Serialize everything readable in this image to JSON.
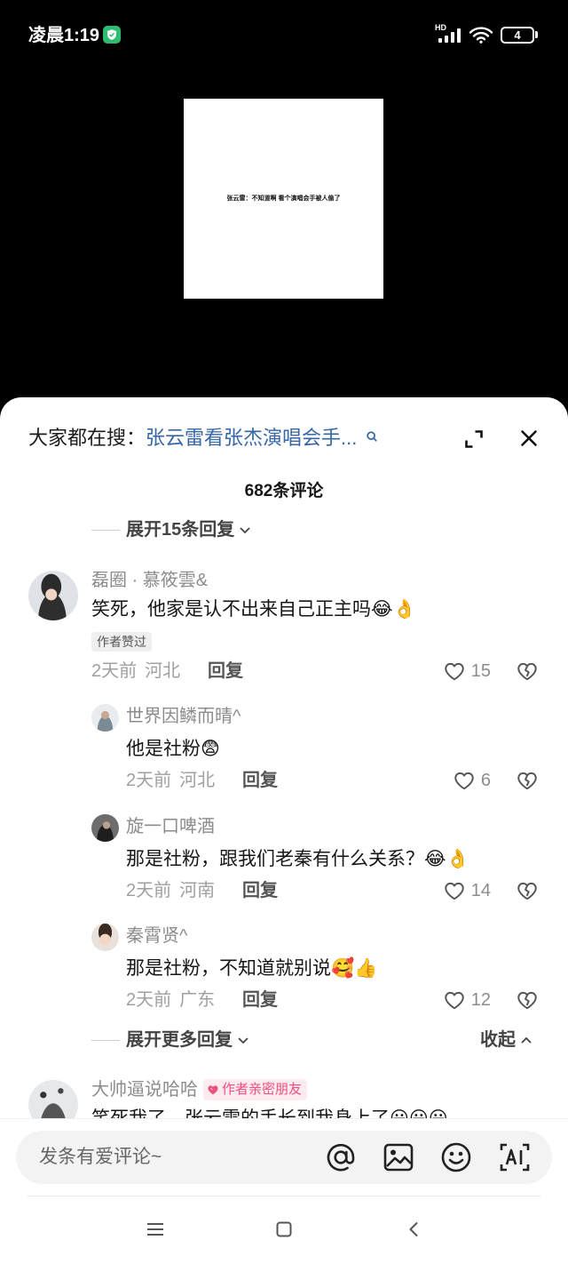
{
  "status_bar": {
    "time": "凌晨1:19",
    "network_label": "HD",
    "battery_level": "4",
    "icons": [
      "shield-badge-icon",
      "signal-icon",
      "wifi-icon",
      "battery-icon"
    ]
  },
  "video": {
    "caption": "张云雷：不知道啊 看个演唱会手被人偷了"
  },
  "search_bar": {
    "prefix": "大家都在搜：",
    "query": "张云雷看张杰演唱会手...",
    "icons": [
      "search-icon",
      "expand-icon",
      "close-icon"
    ]
  },
  "comments_header": {
    "count_label": "682条评论",
    "expand_top_label": "展开15条回复"
  },
  "comments": [
    {
      "author": "磊圈 · 慕筱雲&",
      "text": "笑死，他家是认不出来自己正主吗😂👌",
      "badge": "作者赞过",
      "time": "2天前",
      "location": "河北",
      "reply_label": "回复",
      "likes": "15",
      "replies": [
        {
          "author": "世界因鳞而晴^",
          "text": "他是社粉😨",
          "time": "2天前",
          "location": "河北",
          "reply_label": "回复",
          "likes": "6"
        },
        {
          "author": "旋一口啤酒",
          "text": "那是社粉，跟我们老秦有什么关系？😂👌",
          "time": "2天前",
          "location": "河南",
          "reply_label": "回复",
          "likes": "14"
        },
        {
          "author": "秦霄贤^",
          "text": "那是社粉，不知道就别说🥰👍",
          "time": "2天前",
          "location": "广东",
          "reply_label": "回复",
          "likes": "12"
        }
      ],
      "expand_more_label": "展开更多回复",
      "collapse_label": "收起"
    },
    {
      "author": "大帅逼说哈哈",
      "badge": "作者亲密朋友",
      "text": "笑死我了，张云雷的手长到我身上了😀😀😀"
    }
  ],
  "input_bar": {
    "placeholder": "发条有爱评论~",
    "icons": [
      "at-icon",
      "image-icon",
      "emoji-icon",
      "ai-icon"
    ]
  },
  "nav_bar": {
    "icons": [
      "menu-icon",
      "home-square-icon",
      "back-icon"
    ]
  },
  "colors": {
    "query_blue": "#3567a6",
    "friend_badge_pink": "#ef4f7d",
    "friend_badge_bg": "#fdebf0",
    "shield_green": "#2ebd6e"
  }
}
